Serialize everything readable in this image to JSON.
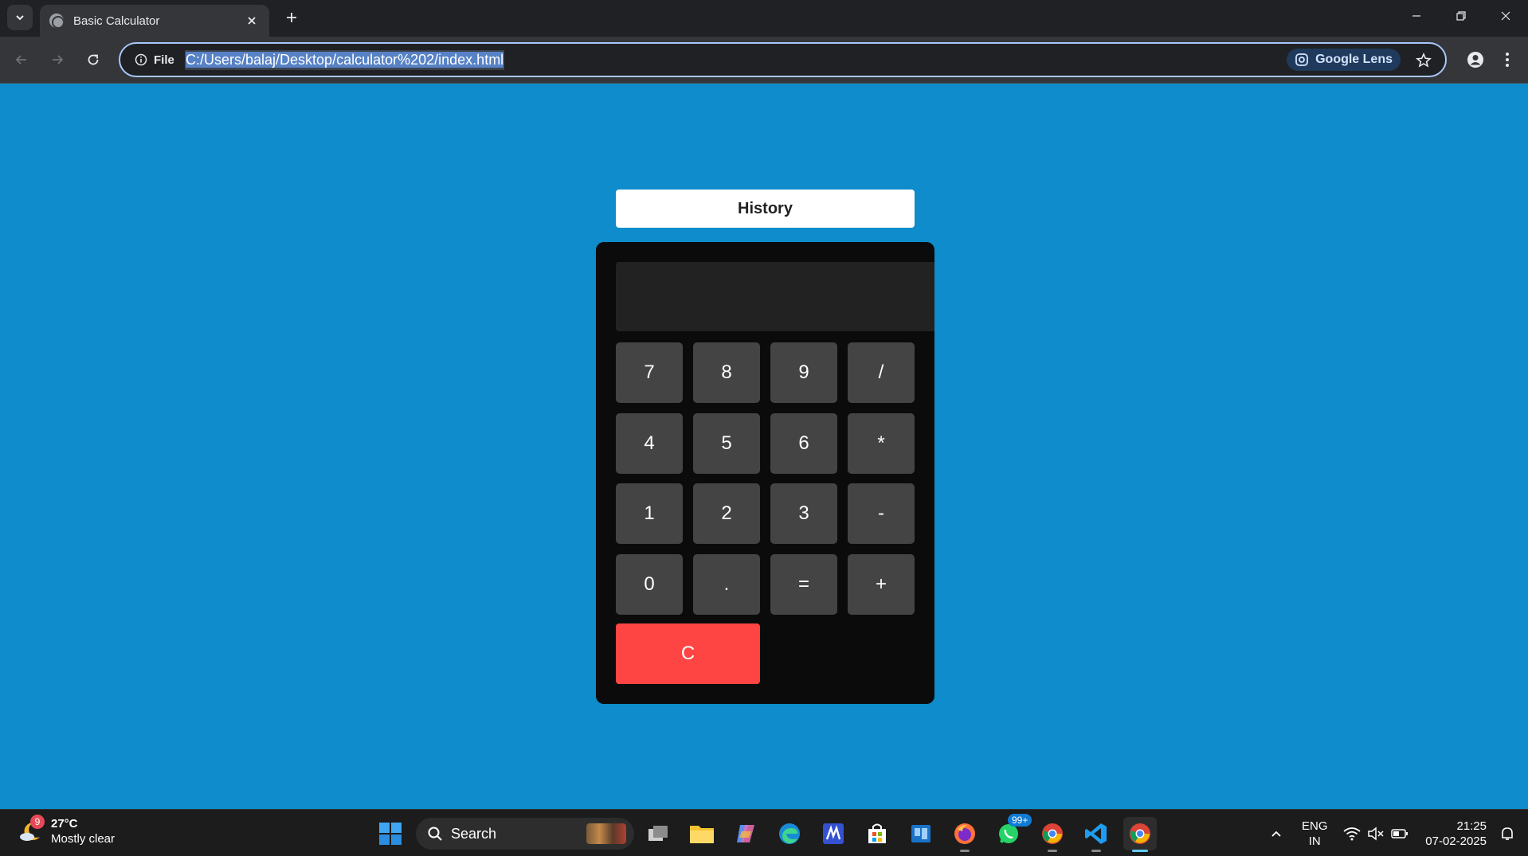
{
  "browser": {
    "tab_title": "Basic Calculator",
    "site_info_label": "File",
    "url": "C:/Users/balaj/Desktop/calculator%202/index.html",
    "lens_label": "Google Lens"
  },
  "page": {
    "background_color": "#0e8ccb",
    "history_label": "History",
    "display_value": "",
    "keys": [
      {
        "label": "7"
      },
      {
        "label": "8"
      },
      {
        "label": "9"
      },
      {
        "label": "/"
      },
      {
        "label": "4"
      },
      {
        "label": "5"
      },
      {
        "label": "6"
      },
      {
        "label": "*"
      },
      {
        "label": "1"
      },
      {
        "label": "2"
      },
      {
        "label": "3"
      },
      {
        "label": "-"
      },
      {
        "label": "0"
      },
      {
        "label": "."
      },
      {
        "label": "="
      },
      {
        "label": "+"
      }
    ],
    "clear_label": "C",
    "clear_color": "#ff4444"
  },
  "taskbar": {
    "weather_temp": "27°C",
    "weather_desc": "Mostly clear",
    "weather_badge": "9",
    "search_placeholder": "Search",
    "whatsapp_badge": "99+",
    "lang_primary": "ENG",
    "lang_region": "IN",
    "time": "21:25",
    "date": "07-02-2025"
  }
}
